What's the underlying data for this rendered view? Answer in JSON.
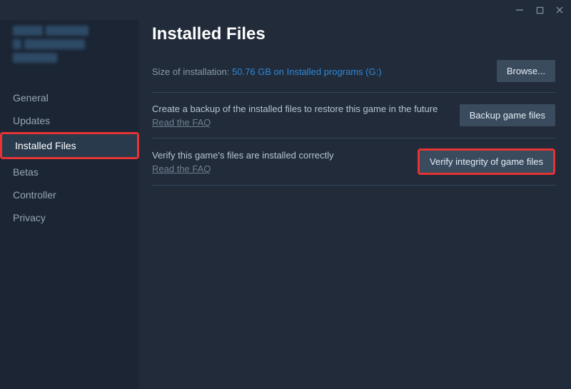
{
  "window": {
    "minimize": "—",
    "maximize": "☐",
    "close": "✕"
  },
  "sidebar": {
    "items": [
      {
        "label": "General"
      },
      {
        "label": "Updates"
      },
      {
        "label": "Installed Files"
      },
      {
        "label": "Betas"
      },
      {
        "label": "Controller"
      },
      {
        "label": "Privacy"
      }
    ]
  },
  "main": {
    "title": "Installed Files",
    "size_label": "Size of installation:  ",
    "size_value": "50.76 GB on Installed programs (G:)",
    "browse_label": "Browse...",
    "backup": {
      "desc": "Create a backup of the installed files to restore this game in the future",
      "faq": "Read the FAQ",
      "button": "Backup game files"
    },
    "verify": {
      "desc": "Verify this game's files are installed correctly",
      "faq": "Read the FAQ",
      "button": "Verify integrity of game files"
    }
  }
}
